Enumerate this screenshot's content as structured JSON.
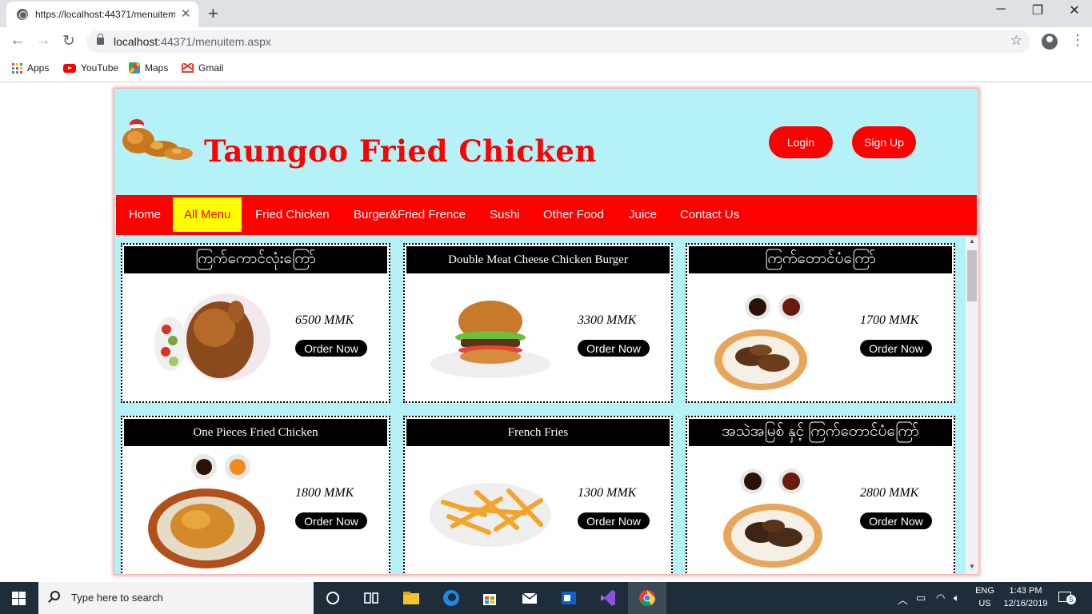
{
  "browser": {
    "tab_title": "https://localhost:44371/menuitem.a",
    "url_host": "localhost",
    "url_rest": ":44371/menuitem.aspx",
    "bookmarks": [
      {
        "label": "Apps",
        "icon": "apps-grid-icon"
      },
      {
        "label": "YouTube",
        "icon": "youtube-icon"
      },
      {
        "label": "Maps",
        "icon": "maps-icon"
      },
      {
        "label": "Gmail",
        "icon": "gmail-icon"
      }
    ]
  },
  "site": {
    "title": "Taungoo Fried Chicken",
    "login_label": "Login",
    "signup_label": "Sign Up",
    "nav": [
      {
        "label": "Home",
        "active": false
      },
      {
        "label": "All Menu",
        "active": true
      },
      {
        "label": "Fried Chicken",
        "active": false
      },
      {
        "label": "Burger&Fried Frence",
        "active": false
      },
      {
        "label": "Sushi",
        "active": false
      },
      {
        "label": "Other Food",
        "active": false
      },
      {
        "label": "Juice",
        "active": false
      },
      {
        "label": "Contact Us",
        "active": false
      }
    ],
    "order_label": "Order Now",
    "items": [
      {
        "name": "ကြက်ကောင်လုံးကြော်",
        "price": "6500 MMK",
        "image": "whole-roast-chicken"
      },
      {
        "name": "Double Meat Cheese Chicken Burger",
        "price": "3300 MMK",
        "image": "burger"
      },
      {
        "name": "ကြက်တောင်ပံကြော်",
        "price": "1700 MMK",
        "image": "chicken-wings-basket"
      },
      {
        "name": "One Pieces Fried Chicken",
        "price": "1800 MMK",
        "image": "fried-chicken-basket"
      },
      {
        "name": "French Fries",
        "price": "1300 MMK",
        "image": "french-fries"
      },
      {
        "name": "အသဲအမြစ် နှင့် ကြက်တောင်ပံကြော်",
        "price": "2800 MMK",
        "image": "liver-wings-basket"
      }
    ]
  },
  "taskbar": {
    "search_placeholder": "Type here to search",
    "lang_top": "ENG",
    "lang_bottom": "US",
    "time": "1:43 PM",
    "date": "12/16/2019",
    "notification_count": "5"
  },
  "colors": {
    "brand_red": "#ff0000",
    "page_bg": "#b5f2f7",
    "active_nav": "#ffff00"
  }
}
